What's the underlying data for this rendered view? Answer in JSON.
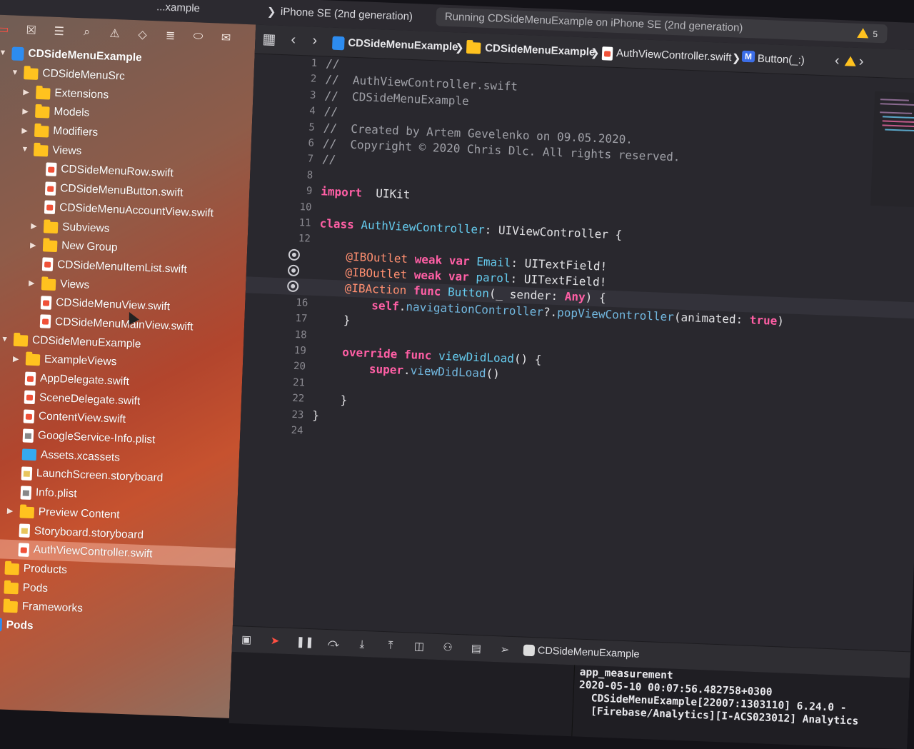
{
  "toolbar": {
    "breadcrumb_project": "...xample",
    "device": "iPhone SE (2nd generation)",
    "status": "Running CDSideMenuExample on iPhone SE (2nd generation)",
    "warning_count": "5"
  },
  "navigator": {
    "tabs": [
      "folder-icon",
      "x-square-icon",
      "hierarchy-icon",
      "search-icon",
      "warning-icon",
      "diamond-icon",
      "list-icon",
      "tag-icon",
      "message-icon"
    ],
    "tree": [
      {
        "label": "CDSideMenuExample",
        "level": 0,
        "type": "project",
        "expanded": true
      },
      {
        "label": "CDSideMenuSrc",
        "level": 1,
        "type": "folder",
        "expanded": true
      },
      {
        "label": "Extensions",
        "level": 2,
        "type": "folder",
        "expanded": false
      },
      {
        "label": "Models",
        "level": 2,
        "type": "folder",
        "expanded": false
      },
      {
        "label": "Modifiers",
        "level": 2,
        "type": "folder",
        "expanded": false
      },
      {
        "label": "Views",
        "level": 2,
        "type": "folder",
        "expanded": true
      },
      {
        "label": "CDSideMenuRow.swift",
        "level": 3,
        "type": "swift"
      },
      {
        "label": "CDSideMenuButton.swift",
        "level": 3,
        "type": "swift"
      },
      {
        "label": "CDSideMenuAccountView.swift",
        "level": 3,
        "type": "swift"
      },
      {
        "label": "Subviews",
        "level": 3,
        "type": "folder",
        "expanded": false
      },
      {
        "label": "New Group",
        "level": 3,
        "type": "folder",
        "expanded": false
      },
      {
        "label": "CDSideMenuItemList.swift",
        "level": 3,
        "type": "swift"
      },
      {
        "label": "Views",
        "level": 3,
        "type": "folder",
        "expanded": false
      },
      {
        "label": "CDSideMenuView.swift",
        "level": 3,
        "type": "swift"
      },
      {
        "label": "CDSideMenuMainView.swift",
        "level": 3,
        "type": "swift"
      },
      {
        "label": "CDSideMenuExample",
        "level": 1,
        "type": "folder",
        "expanded": true
      },
      {
        "label": "ExampleViews",
        "level": 2,
        "type": "folder",
        "expanded": false
      },
      {
        "label": "AppDelegate.swift",
        "level": 2,
        "type": "swift"
      },
      {
        "label": "SceneDelegate.swift",
        "level": 2,
        "type": "swift"
      },
      {
        "label": "ContentView.swift",
        "level": 2,
        "type": "swift"
      },
      {
        "label": "GoogleService-Info.plist",
        "level": 2,
        "type": "plist"
      },
      {
        "label": "Assets.xcassets",
        "level": 2,
        "type": "assets"
      },
      {
        "label": "LaunchScreen.storyboard",
        "level": 2,
        "type": "story"
      },
      {
        "label": "Info.plist",
        "level": 2,
        "type": "plist"
      },
      {
        "label": "Preview Content",
        "level": 2,
        "type": "folder",
        "expanded": false
      },
      {
        "label": "Storyboard.storyboard",
        "level": 2,
        "type": "story"
      },
      {
        "label": "AuthViewController.swift",
        "level": 2,
        "type": "swift",
        "selected": true
      },
      {
        "label": "Products",
        "level": 1,
        "type": "folder",
        "expanded": false
      },
      {
        "label": "Pods",
        "level": 1,
        "type": "folder",
        "expanded": false
      },
      {
        "label": "Frameworks",
        "level": 1,
        "type": "folder",
        "expanded": false
      },
      {
        "label": "Pods",
        "level": 0,
        "type": "project",
        "expanded": false
      }
    ]
  },
  "jumpbar": {
    "project": "CDSideMenuExample",
    "group": "CDSideMenuExample",
    "file": "AuthViewController.swift",
    "method_badge": "M",
    "method": "Button(_:)"
  },
  "code": [
    {
      "n": "1",
      "bp": false,
      "src": [
        [
          "cm",
          "//"
        ]
      ]
    },
    {
      "n": "2",
      "bp": false,
      "src": [
        [
          "cm",
          "//  AuthViewController.swift"
        ]
      ]
    },
    {
      "n": "3",
      "bp": false,
      "src": [
        [
          "cm",
          "//  CDSideMenuExample"
        ]
      ]
    },
    {
      "n": "4",
      "bp": false,
      "src": [
        [
          "cm",
          "//"
        ]
      ]
    },
    {
      "n": "5",
      "bp": false,
      "src": [
        [
          "cm",
          "//  Created by Artem Gevelenko on 09.05.2020."
        ]
      ]
    },
    {
      "n": "6",
      "bp": false,
      "src": [
        [
          "cm",
          "//  Copyright © 2020 Chris Dlc. All rights reserved."
        ]
      ]
    },
    {
      "n": "7",
      "bp": false,
      "src": [
        [
          "cm",
          "//"
        ]
      ]
    },
    {
      "n": "8",
      "bp": false,
      "src": []
    },
    {
      "n": "9",
      "bp": false,
      "src": [
        [
          "kw",
          "import"
        ],
        [
          "",
          "  UIKit"
        ]
      ]
    },
    {
      "n": "10",
      "bp": false,
      "src": []
    },
    {
      "n": "11",
      "bp": false,
      "src": [
        [
          "kw",
          "class"
        ],
        [
          "",
          " "
        ],
        [
          "ty",
          "AuthViewController"
        ],
        [
          "",
          ": UIViewController {"
        ]
      ]
    },
    {
      "n": "12",
      "bp": false,
      "src": []
    },
    {
      "n": "",
      "bp": true,
      "src": [
        [
          "",
          "    "
        ],
        [
          "at",
          "@IBOutlet"
        ],
        [
          "",
          " "
        ],
        [
          "kw",
          "weak var"
        ],
        [
          "",
          " "
        ],
        [
          "ty",
          "Email"
        ],
        [
          "",
          ": UITextField!"
        ]
      ]
    },
    {
      "n": "",
      "bp": true,
      "src": [
        [
          "",
          "    "
        ],
        [
          "at",
          "@IBOutlet"
        ],
        [
          "",
          " "
        ],
        [
          "kw",
          "weak var"
        ],
        [
          "",
          " "
        ],
        [
          "ty",
          "parol"
        ],
        [
          "",
          ": UITextField!"
        ]
      ]
    },
    {
      "n": "",
      "bp": true,
      "current": true,
      "src": [
        [
          "",
          "    "
        ],
        [
          "at",
          "@IBAction"
        ],
        [
          "",
          " "
        ],
        [
          "kw",
          "func"
        ],
        [
          "",
          " "
        ],
        [
          "ty",
          "Button"
        ],
        [
          "",
          "(_ sender: "
        ],
        [
          "kw",
          "Any"
        ],
        [
          "",
          ") {"
        ]
      ]
    },
    {
      "n": "16",
      "bp": false,
      "src": [
        [
          "",
          "        "
        ],
        [
          "kw",
          "self"
        ],
        [
          "",
          "."
        ],
        [
          "pr",
          "navigationController"
        ],
        [
          "",
          "?."
        ],
        [
          "pr",
          "popViewController"
        ],
        [
          "",
          "(animated: "
        ],
        [
          "kw",
          "true"
        ],
        [
          "",
          ")"
        ]
      ]
    },
    {
      "n": "17",
      "bp": false,
      "src": [
        [
          "",
          "    }"
        ]
      ]
    },
    {
      "n": "18",
      "bp": false,
      "src": []
    },
    {
      "n": "19",
      "bp": false,
      "src": [
        [
          "",
          "    "
        ],
        [
          "kw",
          "override func"
        ],
        [
          "",
          " "
        ],
        [
          "ty",
          "viewDidLoad"
        ],
        [
          "",
          "() {"
        ]
      ]
    },
    {
      "n": "20",
      "bp": false,
      "src": [
        [
          "",
          "        "
        ],
        [
          "kw",
          "super"
        ],
        [
          "",
          "."
        ],
        [
          "pr",
          "viewDidLoad"
        ],
        [
          "",
          "()"
        ]
      ]
    },
    {
      "n": "21",
      "bp": false,
      "src": []
    },
    {
      "n": "22",
      "bp": false,
      "src": [
        [
          "",
          "    }"
        ]
      ]
    },
    {
      "n": "23",
      "bp": false,
      "src": [
        [
          "",
          "}"
        ]
      ]
    },
    {
      "n": "24",
      "bp": false,
      "src": []
    }
  ],
  "debugbar": {
    "target": "CDSideMenuExample"
  },
  "console": [
    "app_measurement",
    "2020-05-10 00:07:56.482758+0300",
    "  CDSideMenuExample[22007:1303110] 6.24.0 -",
    "  [Firebase/Analytics][I-ACS023012] Analytics"
  ],
  "colors": {
    "accent": "#ff5fa5",
    "breakpoint": "#cfcfd5",
    "folder": "#ffc21f"
  }
}
